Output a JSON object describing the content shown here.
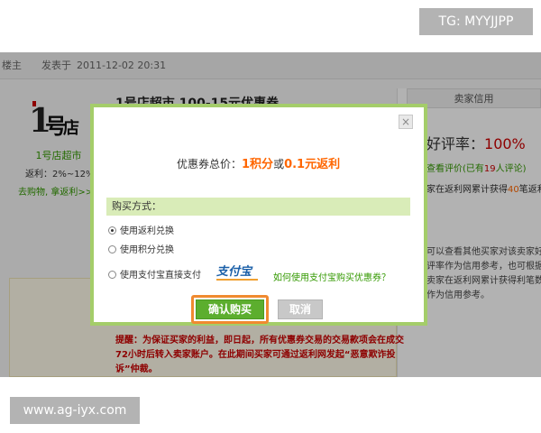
{
  "watermarks": {
    "top": "TG: MYYJJPP",
    "bottom": "www.ag-iyx.com"
  },
  "post": {
    "author_label": "楼主",
    "posted_label": "发表于",
    "time": "2011-12-02 20:31"
  },
  "store": {
    "name": "1号店超市",
    "rebate": "返利：2%~12%",
    "shop_link": "去购物, 拿返利>>",
    "deal_title": "1号店超市 100-15元优惠券"
  },
  "seller": {
    "header": "卖家信用",
    "rating_label": "好评率：",
    "rating_value": "100%",
    "view_reviews": "查看评价",
    "reviews_prefix": "(已有",
    "reviews_count": "19",
    "reviews_suffix": "人评论)",
    "earn_prefix": "家在返利网累计获得",
    "earn_value": "40",
    "earn_suffix": "笔返利",
    "description": "可以查看其他买家对该卖家好评率作为信用参考，也可根据卖家在返利网累计获得利笔数作为信用参考。"
  },
  "reminder": "提醒：为保证买家的利益，即日起，所有优惠券交易的交易款项会在成交72小时后转入卖家账户。在此期间买家可通过返利网发起“恶意欺诈投诉”仲裁。",
  "modal": {
    "close": "×",
    "total_label": "优惠券总价：",
    "total_points": "1积分",
    "total_or": "或",
    "total_cash": "0.1元返利",
    "method_label": "购买方式：",
    "options": [
      {
        "label": "使用返利兑换",
        "selected": true
      },
      {
        "label": "使用积分兑换",
        "selected": false
      },
      {
        "label": "使用支付宝直接支付",
        "selected": false
      }
    ],
    "alipay_logo": "支付宝",
    "alipay_help": "如何使用支付宝购买优惠券？",
    "confirm": "确认购买",
    "cancel": "取消"
  },
  "colors": {
    "accent_green": "#5cae2e",
    "frame_green": "#a4cd6a",
    "highlight_orange": "#f08a30",
    "price_orange": "#ff6600",
    "alert_red": "#cc0000"
  }
}
